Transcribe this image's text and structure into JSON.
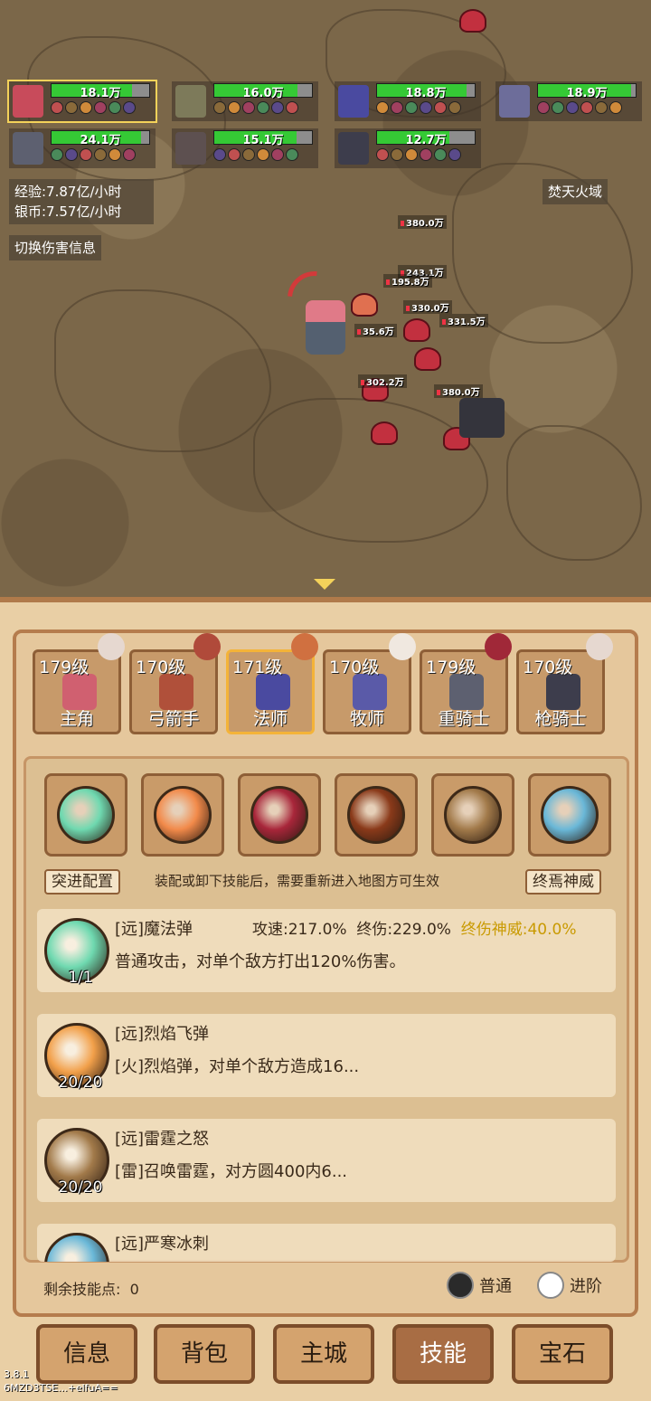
{
  "party": [
    {
      "hp": "18.1万",
      "hp_fill": 0.82,
      "color": "#c84b5b",
      "selected": true
    },
    {
      "hp": "16.0万",
      "hp_fill": 0.85,
      "color": "#7d7a5a",
      "selected": false
    },
    {
      "hp": "18.8万",
      "hp_fill": 0.92,
      "color": "#4a4aa0",
      "selected": false
    },
    {
      "hp": "18.9万",
      "hp_fill": 0.95,
      "color": "#6d6d9a",
      "selected": false
    },
    {
      "hp": "24.1万",
      "hp_fill": 0.92,
      "color": "#5d6070",
      "selected": false
    },
    {
      "hp": "15.1万",
      "hp_fill": 0.84,
      "color": "#5d5050",
      "selected": false
    },
    {
      "hp": "12.7万",
      "hp_fill": 0.74,
      "color": "#3d3d4c",
      "selected": false
    }
  ],
  "stats": {
    "exp": "经验:7.87亿/小时",
    "silver": "银币:7.57亿/小时",
    "toggle_damage": "切换伤害信息",
    "zone_name": "焚天火域"
  },
  "damage_numbers": [
    "380.0万",
    "243.1万",
    "195.8万",
    "330.0万",
    "331.5万",
    "35.6万",
    "302.2万",
    "380.0万"
  ],
  "characters": [
    {
      "level": "179级",
      "name": "主角",
      "color": "#d06070",
      "selected": false
    },
    {
      "level": "170级",
      "name": "弓箭手",
      "color": "#b0503a",
      "selected": false
    },
    {
      "level": "171级",
      "name": "法师",
      "color": "#4a4aa0",
      "selected": true
    },
    {
      "level": "170级",
      "name": "牧师",
      "color": "#5a5aa8",
      "selected": false
    },
    {
      "level": "179级",
      "name": "重骑士",
      "color": "#5d6070",
      "selected": false
    },
    {
      "level": "170级",
      "name": "枪骑士",
      "color": "#3d3d4c",
      "selected": false
    }
  ],
  "skill_slots": [
    {
      "icon": "magic-orb-icon",
      "color": "#6fd9b0"
    },
    {
      "icon": "fireball-icon",
      "color": "#f28a4a"
    },
    {
      "icon": "meteor-icon",
      "color": "#a8263a"
    },
    {
      "icon": "dark-fist-icon",
      "color": "#8a3a1a"
    },
    {
      "icon": "thunder-icon",
      "color": "#a27a4a"
    },
    {
      "icon": "ice-shard-icon",
      "color": "#6ab8d8"
    }
  ],
  "config": {
    "rush_config": "突进配置",
    "note": "装配或卸下技能后，需要重新进入地图方可生效",
    "ultimate": "终焉神威"
  },
  "skill_list": [
    {
      "title": "[远]魔法弹",
      "desc": "普通攻击，对单个敌方打出120%伤害。",
      "count": "1/1",
      "color": "#6fd9b0",
      "attack_speed": "攻速:217.0%",
      "final_damage": "终伤:229.0%",
      "ultimate": "终伤神威:40.0%"
    },
    {
      "title": "[远]烈焰飞弹",
      "desc": "[火]烈焰弹，对单个敌方造成16...",
      "count": "20/20",
      "color": "#f2a04a"
    },
    {
      "title": "[远]雷霆之怒",
      "desc": "[雷]召唤雷霆，对方圆400内6...",
      "count": "20/20",
      "color": "#a27a4a"
    },
    {
      "title": "[远]严寒冰刺",
      "desc": "",
      "count": "",
      "color": "#6ab8d8"
    }
  ],
  "footer": {
    "points_label": "剩余技能点:",
    "points_value": "0",
    "mode_normal": "普通",
    "mode_advanced": "进阶"
  },
  "tabs": [
    {
      "label": "信息",
      "active": false
    },
    {
      "label": "背包",
      "active": false
    },
    {
      "label": "主城",
      "active": false
    },
    {
      "label": "技能",
      "active": true
    },
    {
      "label": "宝石",
      "active": false
    }
  ],
  "version": {
    "number": "3.8.1",
    "id": "6MZD3TSE...+elfuA=="
  }
}
